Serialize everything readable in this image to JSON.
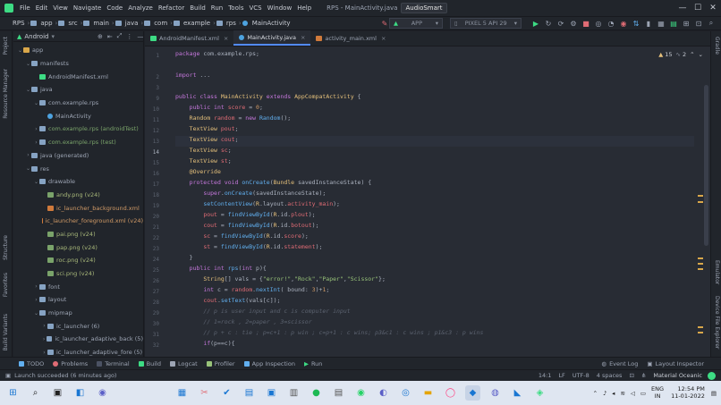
{
  "menubar": {
    "items": [
      "File",
      "Edit",
      "View",
      "Navigate",
      "Code",
      "Analyze",
      "Refactor",
      "Build",
      "Run",
      "Tools",
      "VCS",
      "Window",
      "Help"
    ],
    "title": "RPS - MainActivity.java",
    "badge": "AudioSmart"
  },
  "breadcrumbs": [
    "RPS",
    "app",
    "src",
    "main",
    "java",
    "com",
    "example",
    "rps",
    "MainActivity"
  ],
  "toolbar": {
    "config": "APP",
    "device": "PIXEL 5 API 29"
  },
  "project_panel": {
    "view": "Android",
    "tree": [
      {
        "label": "app",
        "depth": 0,
        "icon": "folder-y",
        "expanded": true
      },
      {
        "label": "manifests",
        "depth": 1,
        "icon": "folder",
        "expanded": true
      },
      {
        "label": "AndroidManifest.xml",
        "depth": 2,
        "icon": "and",
        "expanded": null
      },
      {
        "label": "java",
        "depth": 1,
        "icon": "folder",
        "expanded": true
      },
      {
        "label": "com.example.rps",
        "depth": 2,
        "icon": "folder",
        "expanded": true
      },
      {
        "label": "MainActivity",
        "depth": 3,
        "icon": "java",
        "expanded": null
      },
      {
        "label": "com.example.rps (androidTest)",
        "depth": 2,
        "icon": "folder",
        "expanded": false
      },
      {
        "label": "com.example.rps (test)",
        "depth": 2,
        "icon": "folder",
        "expanded": false
      },
      {
        "label": "java (generated)",
        "depth": 1,
        "icon": "folder",
        "expanded": false
      },
      {
        "label": "res",
        "depth": 1,
        "icon": "folder",
        "expanded": true
      },
      {
        "label": "drawable",
        "depth": 2,
        "icon": "folder",
        "expanded": true
      },
      {
        "label": "andy.png (v24)",
        "depth": 3,
        "icon": "png",
        "expanded": null
      },
      {
        "label": "ic_launcher_background.xml",
        "depth": 3,
        "icon": "xml",
        "expanded": null
      },
      {
        "label": "ic_launcher_foreground.xml (v24)",
        "depth": 3,
        "icon": "xml",
        "expanded": null
      },
      {
        "label": "pai.png (v24)",
        "depth": 3,
        "icon": "png",
        "expanded": null
      },
      {
        "label": "pap.png (v24)",
        "depth": 3,
        "icon": "png",
        "expanded": null
      },
      {
        "label": "roc.png (v24)",
        "depth": 3,
        "icon": "png",
        "expanded": null
      },
      {
        "label": "sci.png (v24)",
        "depth": 3,
        "icon": "png",
        "expanded": null
      },
      {
        "label": "font",
        "depth": 2,
        "icon": "folder",
        "expanded": false
      },
      {
        "label": "layout",
        "depth": 2,
        "icon": "folder",
        "expanded": false
      },
      {
        "label": "mipmap",
        "depth": 2,
        "icon": "folder",
        "expanded": true
      },
      {
        "label": "ic_launcher (6)",
        "depth": 3,
        "icon": "folder",
        "expanded": false
      },
      {
        "label": "ic_launcher_adaptive_back (5)",
        "depth": 3,
        "icon": "folder",
        "expanded": false
      },
      {
        "label": "ic_launcher_adaptive_fore (5)",
        "depth": 3,
        "icon": "folder",
        "expanded": false
      }
    ]
  },
  "left_tools": [
    "Project",
    "Resource Manager",
    "Structure",
    "Favorites",
    "Build Variants"
  ],
  "right_tools": [
    "Gradle",
    "Emulator",
    "Device File Explorer"
  ],
  "tabs": [
    {
      "label": "AndroidManifest.xml",
      "icon": "and",
      "active": false
    },
    {
      "label": "MainActivity.java",
      "icon": "java",
      "active": true
    },
    {
      "label": "activity_main.xml",
      "icon": "xml",
      "active": false
    }
  ],
  "inspection": {
    "warnings": "15",
    "weak": "2"
  },
  "code": {
    "line_numbers": [
      "1",
      "2",
      "3",
      "9",
      "10",
      "11",
      "12",
      "13",
      "14",
      "15",
      "16",
      "17",
      "18",
      "19",
      "20",
      "21",
      "22",
      "23",
      "24",
      "25",
      "26",
      "27",
      "28",
      "29",
      "30",
      "31",
      "32",
      "33",
      "34"
    ],
    "current_line": "14"
  },
  "bottom_tools": [
    "TODO",
    "Problems",
    "Terminal",
    "Build",
    "Logcat",
    "Profiler",
    "App Inspection",
    "Run"
  ],
  "bottom_right_tools": [
    "Event Log",
    "Layout Inspector"
  ],
  "status": {
    "message": "Launch succeeded (6 minutes ago)",
    "position": "14:1",
    "line_sep": "LF",
    "encoding": "UTF-8",
    "indent": "4 spaces",
    "theme": "Material Oceanic"
  },
  "taskbar": {
    "lang": "ENG",
    "region": "IN",
    "time": "12:54 PM",
    "date": "11-01-2022"
  }
}
